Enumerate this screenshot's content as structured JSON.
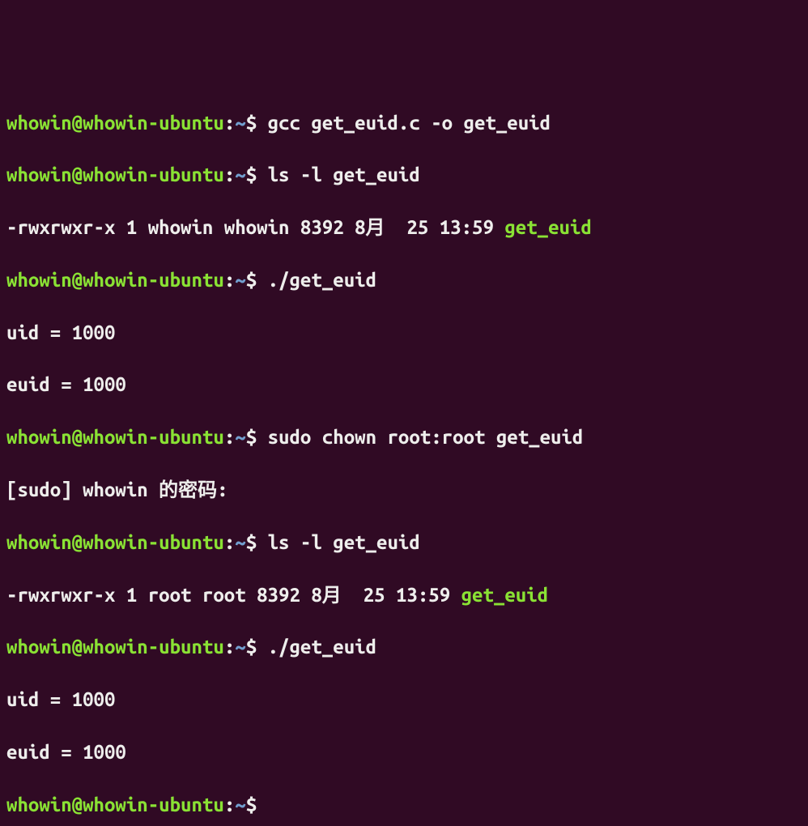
{
  "prompt": {
    "user_host": "whowin@whowin-ubuntu",
    "colon": ":",
    "path": "~",
    "dollar": "$"
  },
  "lines": {
    "cmd1": " gcc get_euid.c -o get_euid",
    "cmd2": " ls -l get_euid",
    "ls1_prefix": "-rwxrwxr-x 1 whowin whowin 8392 8月  25 13:59 ",
    "ls1_file": "get_euid",
    "cmd3": " ./get_euid",
    "out_uid1": "uid = 1000",
    "out_euid1": "euid = 1000",
    "cmd4": " sudo chown root:root get_euid",
    "sudo_pw": "[sudo] whowin 的密码:",
    "cmd5": " ls -l get_euid",
    "ls2_prefix": "-rwxrwxr-x 1 root root 8392 8月  25 13:59 ",
    "ls2_file": "get_euid",
    "cmd6": " ./get_euid",
    "out_uid2": "uid = 1000",
    "out_euid2": "euid = 1000",
    "cmd7": " "
  }
}
